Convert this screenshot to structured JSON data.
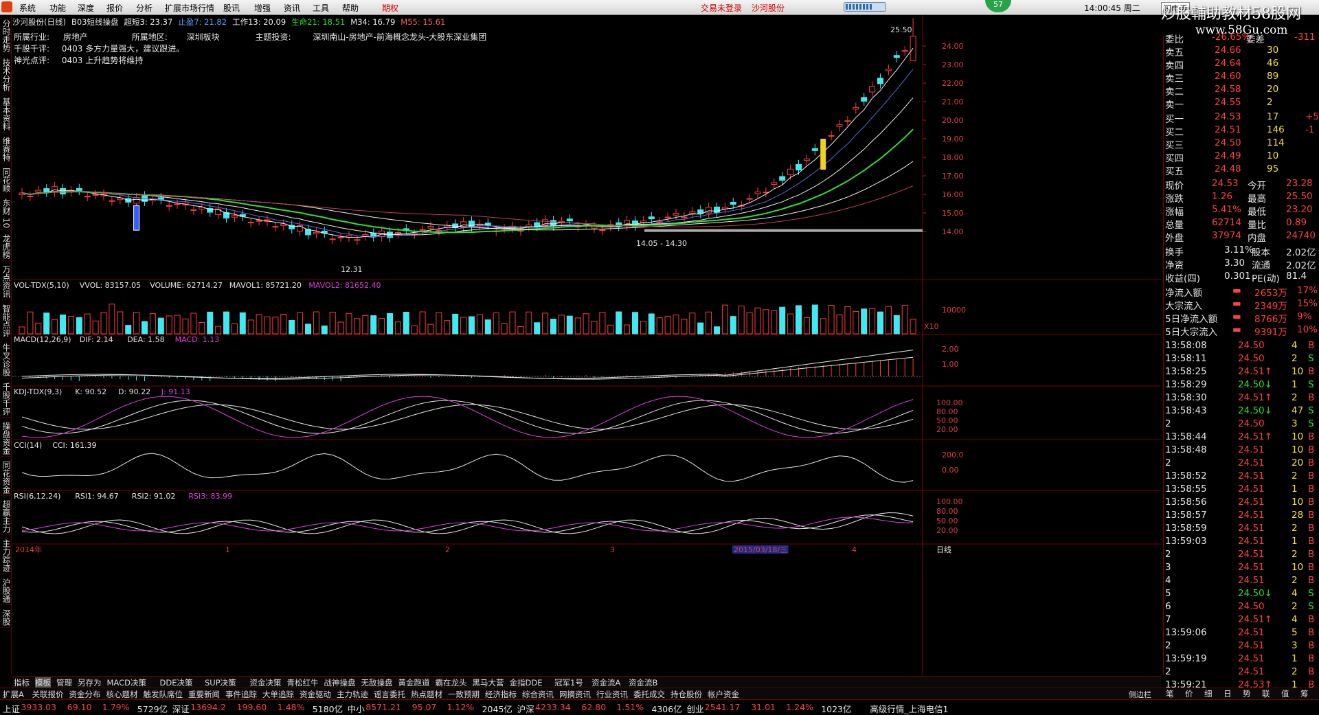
{
  "menu": {
    "items": [
      "系统",
      "功能",
      "深度",
      "报价",
      "分析",
      "扩展市场行情",
      "股讯",
      "增强",
      "资讯",
      "工具",
      "帮助",
      "期权"
    ],
    "notice1": "交易未登录",
    "notice2": "沙河股份",
    "badge": "57",
    "clock": "14:00:45 周二",
    "flash": "闪电手"
  },
  "watermark": {
    "line1": "炒股輔助教材58股网",
    "line2": "www.58Gu.com"
  },
  "left_tabs": [
    "分时走势",
    "技术分析",
    "基本资料",
    "维赛特",
    "同花顺",
    "东财 10",
    "龙虎榜",
    "万点资讯",
    "智能点评",
    "牛叉诊股",
    "千股千评",
    "操盘资金",
    "同花资金",
    "超赢主力",
    "主力踪迹",
    "沪股通",
    "深股"
  ],
  "stock": {
    "name": "沙河股份(日线)",
    "indicator": "B03短线操盘",
    "ind_vals": [
      {
        "t": "超短3: 23.37",
        "c": "#f0f0f0"
      },
      {
        "t": "止盈7: 21.82",
        "c": "#5aa0ff"
      },
      {
        "t": "工作13: 20.09",
        "c": "#f0f0f0"
      },
      {
        "t": "生命21: 18.51",
        "c": "#33dd33"
      },
      {
        "t": "M34: 16.79",
        "c": "#f0f0f0"
      },
      {
        "t": "M55: 15.61",
        "c": "#ff6060"
      }
    ]
  },
  "info": {
    "industry_label": "所属行业:",
    "industry": "房地产",
    "region_label": "所属地区:",
    "region": "深圳板块",
    "theme_label": "主题投资:",
    "theme": "深圳南山-房地产-前海概念龙头-大股东深业集团",
    "qianping_label": "千股千评:",
    "qianping": "0403 多方力量强大，建议跟进。",
    "shenguang_label": "神光点评:",
    "shenguang": "0403 上升趋势将维持"
  },
  "price_axis": [
    "24.00",
    "23.00",
    "22.00",
    "21.00",
    "20.00",
    "19.00",
    "18.00",
    "17.00",
    "16.00",
    "15.00",
    "14.00"
  ],
  "annotations": {
    "high": "25.50",
    "low": "12.31",
    "range": "14.05 - 14.30"
  },
  "vol": {
    "title": [
      "VOL-TDX(5,10)",
      "VVOL: 83157.05",
      "VOLUME: 62714.27",
      "MAVOL1: 85721.20",
      "MAVOL2: 81652.40"
    ],
    "axis": [
      "10000",
      "X10"
    ]
  },
  "macd": {
    "title": [
      "MACD(12,26,9)",
      "DIF: 2.14",
      "DEA: 1.58",
      "MACD: 1.13"
    ],
    "axis": [
      "2.00",
      "1.00"
    ]
  },
  "kdj": {
    "title": [
      "KDJ-TDX(9,3)",
      "K: 90.52",
      "D: 90.22",
      "J: 91.13"
    ],
    "axis": [
      "100.00",
      "80.00",
      "50.00",
      "20.00"
    ]
  },
  "cci": {
    "title": [
      "CCI(14)",
      "CCI: 161.39"
    ],
    "axis": [
      "200.0",
      "0.00"
    ]
  },
  "rsi": {
    "title": [
      "RSI(6,12,24)",
      "RSI1: 94.67",
      "RSI2: 91.02",
      "RSI3: 83.99"
    ],
    "axis": [
      "100.00",
      "80.00",
      "50.00",
      "20.00"
    ]
  },
  "date_axis": {
    "labels": [
      "2014年",
      "1",
      "2",
      "3",
      "2015/03/18/三",
      "4"
    ],
    "mode": "日线"
  },
  "quote": {
    "top": {
      "l1": "委比",
      "v1": "-26.65%",
      "l2": "委差",
      "v2": "-311"
    },
    "sell": [
      {
        "l": "卖五",
        "p": "24.66",
        "v": "30"
      },
      {
        "l": "卖四",
        "p": "24.64",
        "v": "46"
      },
      {
        "l": "卖三",
        "p": "24.60",
        "v": "89"
      },
      {
        "l": "卖二",
        "p": "24.58",
        "v": "20"
      },
      {
        "l": "卖一",
        "p": "24.55",
        "v": "2"
      }
    ],
    "buy": [
      {
        "l": "买一",
        "p": "24.53",
        "v": "17",
        "d": "+5"
      },
      {
        "l": "买二",
        "p": "24.51",
        "v": "146",
        "d": "-1"
      },
      {
        "l": "买三",
        "p": "24.50",
        "v": "114",
        "d": ""
      },
      {
        "l": "买四",
        "p": "24.49",
        "v": "10",
        "d": ""
      },
      {
        "l": "买五",
        "p": "24.48",
        "v": "95",
        "d": ""
      }
    ],
    "stats": [
      {
        "l1": "现价",
        "v1": "24.53",
        "l2": "今开",
        "v2": "23.28"
      },
      {
        "l1": "涨跌",
        "v1": "1.26",
        "l2": "最高",
        "v2": "25.50"
      },
      {
        "l1": "涨幅",
        "v1": "5.41%",
        "l2": "最低",
        "v2": "23.20"
      },
      {
        "l1": "总量",
        "v1": "62714",
        "l2": "量比",
        "v2": "0.89"
      },
      {
        "l1": "外盘",
        "v1": "37974",
        "l2": "内盘",
        "v2": "24740"
      }
    ],
    "stats2": [
      {
        "l1": "换手",
        "v1": "3.11%",
        "l2": "股本",
        "v2": "2.02亿"
      },
      {
        "l1": "净资",
        "v1": "3.30",
        "l2": "流通",
        "v2": "2.02亿"
      },
      {
        "l1": "收益(四)",
        "v1": "0.301",
        "l2": "PE(动)",
        "v2": "81.4"
      }
    ],
    "flows": [
      {
        "l": "净流入额",
        "v": "2653万",
        "p": "17%"
      },
      {
        "l": "大宗流入",
        "v": "2349万",
        "p": "15%"
      },
      {
        "l": "5日净流入额",
        "v": "8766万",
        "p": "9%"
      },
      {
        "l": "5日大宗流入",
        "v": "9391万",
        "p": "10%"
      }
    ],
    "ticks": [
      {
        "t": "13:58:08",
        "p": "24.50",
        "v": "4",
        "s": "B"
      },
      {
        "t": "13:58:11",
        "p": "24.50",
        "v": "2",
        "s": "S"
      },
      {
        "t": "13:58:25",
        "p": "24.51↑",
        "v": "10",
        "s": "B"
      },
      {
        "t": "13:58:29",
        "p": "24.50↓",
        "v": "1",
        "s": "S"
      },
      {
        "t": "13:58:30",
        "p": "24.51↑",
        "v": "2",
        "s": "B"
      },
      {
        "t": "13:58:43",
        "p": "24.50↓",
        "v": "47",
        "s": "S"
      },
      {
        "t": "2",
        "p": "24.50",
        "v": "3",
        "s": "S"
      },
      {
        "t": "13:58:44",
        "p": "24.51↑",
        "v": "10",
        "s": "B"
      },
      {
        "t": "13:58:48",
        "p": "24.51",
        "v": "10",
        "s": "B"
      },
      {
        "t": "2",
        "p": "24.51",
        "v": "20",
        "s": "B"
      },
      {
        "t": "13:58:52",
        "p": "24.51",
        "v": "2",
        "s": "B"
      },
      {
        "t": "13:58:55",
        "p": "24.51",
        "v": "1",
        "s": "B"
      },
      {
        "t": "13:58:56",
        "p": "24.51",
        "v": "10",
        "s": "B"
      },
      {
        "t": "13:58:57",
        "p": "24.51",
        "v": "28",
        "s": "B"
      },
      {
        "t": "13:58:59",
        "p": "24.51",
        "v": "2",
        "s": "B"
      },
      {
        "t": "13:59:03",
        "p": "24.51",
        "v": "1",
        "s": "B"
      },
      {
        "t": "2",
        "p": "24.51",
        "v": "2",
        "s": "B"
      },
      {
        "t": "3",
        "p": "24.51",
        "v": "10",
        "s": "B"
      },
      {
        "t": "4",
        "p": "24.51",
        "v": "2",
        "s": "B"
      },
      {
        "t": "5",
        "p": "24.50↓",
        "v": "4",
        "s": "S"
      },
      {
        "t": "6",
        "p": "24.50",
        "v": "2",
        "s": "S"
      },
      {
        "t": "7",
        "p": "24.51↑",
        "v": "4",
        "s": "B"
      },
      {
        "t": "13:59:06",
        "p": "24.51",
        "v": "5",
        "s": "B"
      },
      {
        "t": "2",
        "p": "24.51",
        "v": "3",
        "s": "B"
      },
      {
        "t": "13:59:19",
        "p": "24.51",
        "v": "1",
        "s": "B"
      },
      {
        "t": "2",
        "p": "24.51",
        "v": "2",
        "s": "B"
      },
      {
        "t": "13:59:21",
        "p": "24.53↑",
        "v": "1",
        "s": "B"
      }
    ]
  },
  "bottom_tabs1": [
    "指标",
    "模板",
    "管理",
    "另存为",
    "MACD决策",
    "DDE决策",
    "SUP决策",
    "资金决策",
    "青松红牛",
    "战神操盘",
    "无敌操盘",
    "黄金跑道",
    "霸在龙头",
    "黑马大营",
    "金指DDE",
    "冠军1号",
    "资金流A",
    "资金流B"
  ],
  "bottom_tabs2": [
    "扩展A",
    "关联报价",
    "资金分布",
    "核心题材",
    "触发队席位",
    "重要新闻",
    "事件追踪",
    "大单追踪",
    "资金驱动",
    "主力轨迹",
    "谣言委托",
    "热点题材",
    "一致预期",
    "经济指标",
    "综合资讯",
    "网摘资讯",
    "行业资讯",
    "委托成交",
    "持仓股份",
    "帐户资金"
  ],
  "right_tabs": [
    "笔",
    "价",
    "细",
    "日",
    "势",
    "联",
    "值",
    "筹"
  ],
  "sidebar_ctrl": "侧边栏",
  "status": [
    {
      "t": "上证",
      "c": "#e6e6e6"
    },
    {
      "t": "3933.03",
      "c": "#ff4040"
    },
    {
      "t": "69.10",
      "c": "#ff4040"
    },
    {
      "t": "1.79%",
      "c": "#ff4040"
    },
    {
      "t": "5729亿",
      "c": "#e6e6e6"
    },
    {
      "t": "深证",
      "c": "#e6e6e6"
    },
    {
      "t": "13694.2",
      "c": "#ff4040"
    },
    {
      "t": "199.60",
      "c": "#ff4040"
    },
    {
      "t": "1.48%",
      "c": "#ff4040"
    },
    {
      "t": "5180亿",
      "c": "#e6e6e6"
    },
    {
      "t": "中小",
      "c": "#e6e6e6"
    },
    {
      "t": "8571.21",
      "c": "#ff4040"
    },
    {
      "t": "95.07",
      "c": "#ff4040"
    },
    {
      "t": "1.12%",
      "c": "#ff4040"
    },
    {
      "t": "2045亿",
      "c": "#e6e6e6"
    },
    {
      "t": "沪深",
      "c": "#e6e6e6"
    },
    {
      "t": "4233.34",
      "c": "#ff4040"
    },
    {
      "t": "62.80",
      "c": "#ff4040"
    },
    {
      "t": "1.51%",
      "c": "#ff4040"
    },
    {
      "t": "4306亿",
      "c": "#e6e6e6"
    },
    {
      "t": "创业",
      "c": "#e6e6e6"
    },
    {
      "t": "2541.17",
      "c": "#ff4040"
    },
    {
      "t": "31.01",
      "c": "#ff4040"
    },
    {
      "t": "1.24%",
      "c": "#ff4040"
    },
    {
      "t": "1023亿",
      "c": "#e6e6e6"
    },
    {
      "t": "高级行情_上海电信1",
      "c": "#e6e6e6"
    }
  ],
  "colors": {
    "up": "#ff3c3c",
    "down": "#40e8f0",
    "ma_green": "#33dd33",
    "ma_blue": "#5a6ad8",
    "ma_red": "#c04050",
    "marker_yellow": "#f0d020",
    "marker_blue": "#3060ff"
  }
}
